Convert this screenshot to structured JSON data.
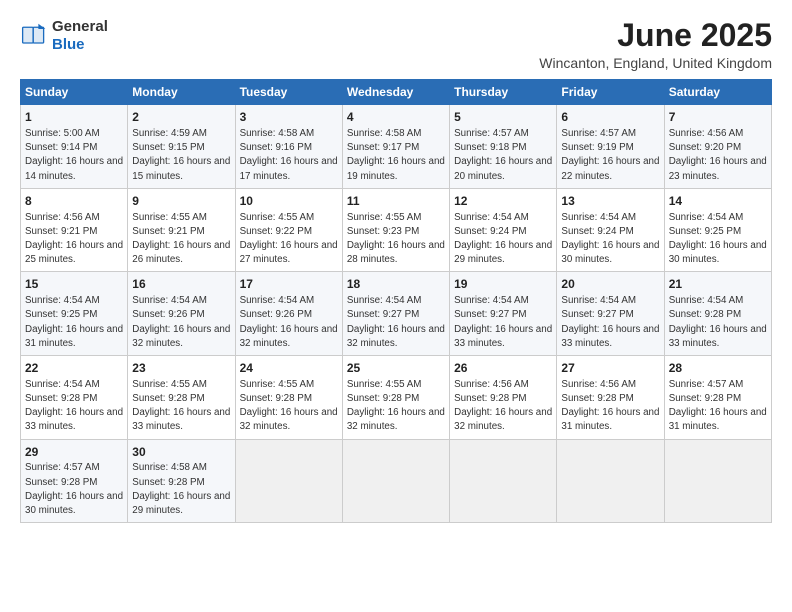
{
  "header": {
    "logo_general": "General",
    "logo_blue": "Blue",
    "month_title": "June 2025",
    "location": "Wincanton, England, United Kingdom"
  },
  "weekdays": [
    "Sunday",
    "Monday",
    "Tuesday",
    "Wednesday",
    "Thursday",
    "Friday",
    "Saturday"
  ],
  "weeks": [
    [
      {
        "day": "1",
        "sunrise": "5:00 AM",
        "sunset": "9:14 PM",
        "daylight": "16 hours and 14 minutes."
      },
      {
        "day": "2",
        "sunrise": "4:59 AM",
        "sunset": "9:15 PM",
        "daylight": "16 hours and 15 minutes."
      },
      {
        "day": "3",
        "sunrise": "4:58 AM",
        "sunset": "9:16 PM",
        "daylight": "16 hours and 17 minutes."
      },
      {
        "day": "4",
        "sunrise": "4:58 AM",
        "sunset": "9:17 PM",
        "daylight": "16 hours and 19 minutes."
      },
      {
        "day": "5",
        "sunrise": "4:57 AM",
        "sunset": "9:18 PM",
        "daylight": "16 hours and 20 minutes."
      },
      {
        "day": "6",
        "sunrise": "4:57 AM",
        "sunset": "9:19 PM",
        "daylight": "16 hours and 22 minutes."
      },
      {
        "day": "7",
        "sunrise": "4:56 AM",
        "sunset": "9:20 PM",
        "daylight": "16 hours and 23 minutes."
      }
    ],
    [
      {
        "day": "8",
        "sunrise": "4:56 AM",
        "sunset": "9:21 PM",
        "daylight": "16 hours and 25 minutes."
      },
      {
        "day": "9",
        "sunrise": "4:55 AM",
        "sunset": "9:21 PM",
        "daylight": "16 hours and 26 minutes."
      },
      {
        "day": "10",
        "sunrise": "4:55 AM",
        "sunset": "9:22 PM",
        "daylight": "16 hours and 27 minutes."
      },
      {
        "day": "11",
        "sunrise": "4:55 AM",
        "sunset": "9:23 PM",
        "daylight": "16 hours and 28 minutes."
      },
      {
        "day": "12",
        "sunrise": "4:54 AM",
        "sunset": "9:24 PM",
        "daylight": "16 hours and 29 minutes."
      },
      {
        "day": "13",
        "sunrise": "4:54 AM",
        "sunset": "9:24 PM",
        "daylight": "16 hours and 30 minutes."
      },
      {
        "day": "14",
        "sunrise": "4:54 AM",
        "sunset": "9:25 PM",
        "daylight": "16 hours and 30 minutes."
      }
    ],
    [
      {
        "day": "15",
        "sunrise": "4:54 AM",
        "sunset": "9:25 PM",
        "daylight": "16 hours and 31 minutes."
      },
      {
        "day": "16",
        "sunrise": "4:54 AM",
        "sunset": "9:26 PM",
        "daylight": "16 hours and 32 minutes."
      },
      {
        "day": "17",
        "sunrise": "4:54 AM",
        "sunset": "9:26 PM",
        "daylight": "16 hours and 32 minutes."
      },
      {
        "day": "18",
        "sunrise": "4:54 AM",
        "sunset": "9:27 PM",
        "daylight": "16 hours and 32 minutes."
      },
      {
        "day": "19",
        "sunrise": "4:54 AM",
        "sunset": "9:27 PM",
        "daylight": "16 hours and 33 minutes."
      },
      {
        "day": "20",
        "sunrise": "4:54 AM",
        "sunset": "9:27 PM",
        "daylight": "16 hours and 33 minutes."
      },
      {
        "day": "21",
        "sunrise": "4:54 AM",
        "sunset": "9:28 PM",
        "daylight": "16 hours and 33 minutes."
      }
    ],
    [
      {
        "day": "22",
        "sunrise": "4:54 AM",
        "sunset": "9:28 PM",
        "daylight": "16 hours and 33 minutes."
      },
      {
        "day": "23",
        "sunrise": "4:55 AM",
        "sunset": "9:28 PM",
        "daylight": "16 hours and 33 minutes."
      },
      {
        "day": "24",
        "sunrise": "4:55 AM",
        "sunset": "9:28 PM",
        "daylight": "16 hours and 32 minutes."
      },
      {
        "day": "25",
        "sunrise": "4:55 AM",
        "sunset": "9:28 PM",
        "daylight": "16 hours and 32 minutes."
      },
      {
        "day": "26",
        "sunrise": "4:56 AM",
        "sunset": "9:28 PM",
        "daylight": "16 hours and 32 minutes."
      },
      {
        "day": "27",
        "sunrise": "4:56 AM",
        "sunset": "9:28 PM",
        "daylight": "16 hours and 31 minutes."
      },
      {
        "day": "28",
        "sunrise": "4:57 AM",
        "sunset": "9:28 PM",
        "daylight": "16 hours and 31 minutes."
      }
    ],
    [
      {
        "day": "29",
        "sunrise": "4:57 AM",
        "sunset": "9:28 PM",
        "daylight": "16 hours and 30 minutes."
      },
      {
        "day": "30",
        "sunrise": "4:58 AM",
        "sunset": "9:28 PM",
        "daylight": "16 hours and 29 minutes."
      },
      null,
      null,
      null,
      null,
      null
    ]
  ]
}
